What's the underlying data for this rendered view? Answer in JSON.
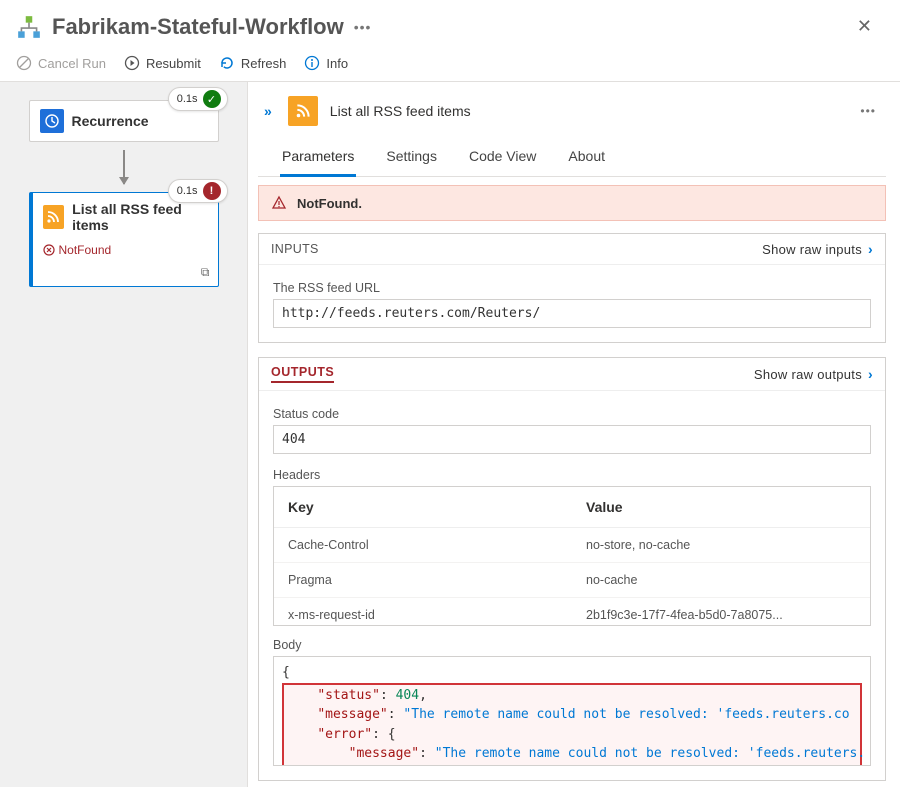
{
  "header": {
    "title": "Fabrikam-Stateful-Workflow"
  },
  "toolbar": {
    "cancel": "Cancel Run",
    "resubmit": "Resubmit",
    "refresh": "Refresh",
    "info": "Info"
  },
  "canvas": {
    "node1": {
      "title": "Recurrence",
      "duration": "0.1s"
    },
    "node2": {
      "title": "List all RSS feed items",
      "duration": "0.1s",
      "error": "NotFound"
    }
  },
  "detail": {
    "title": "List all RSS feed items",
    "tabs": {
      "parameters": "Parameters",
      "settings": "Settings",
      "codeview": "Code View",
      "about": "About"
    },
    "banner": "NotFound.",
    "inputs": {
      "heading": "INPUTS",
      "raw": "Show raw inputs",
      "url_label": "The RSS feed URL",
      "url_value": "http://feeds.reuters.com/Reuters/"
    },
    "outputs": {
      "heading": "OUTPUTS",
      "raw": "Show raw outputs",
      "status_label": "Status code",
      "status_value": "404",
      "headers_label": "Headers",
      "key_col": "Key",
      "value_col": "Value",
      "headers": [
        {
          "k": "Cache-Control",
          "v": "no-store, no-cache"
        },
        {
          "k": "Pragma",
          "v": "no-cache"
        },
        {
          "k": "x-ms-request-id",
          "v": "2b1f9c3e-17f7-4fea-b5d0-7a8075..."
        }
      ],
      "body_label": "Body",
      "body": {
        "status": 404,
        "message": "The remote name could not be resolved: 'feeds.reuters.co",
        "inner_message": "The remote name could not be resolved: 'feeds.reuters."
      }
    }
  }
}
